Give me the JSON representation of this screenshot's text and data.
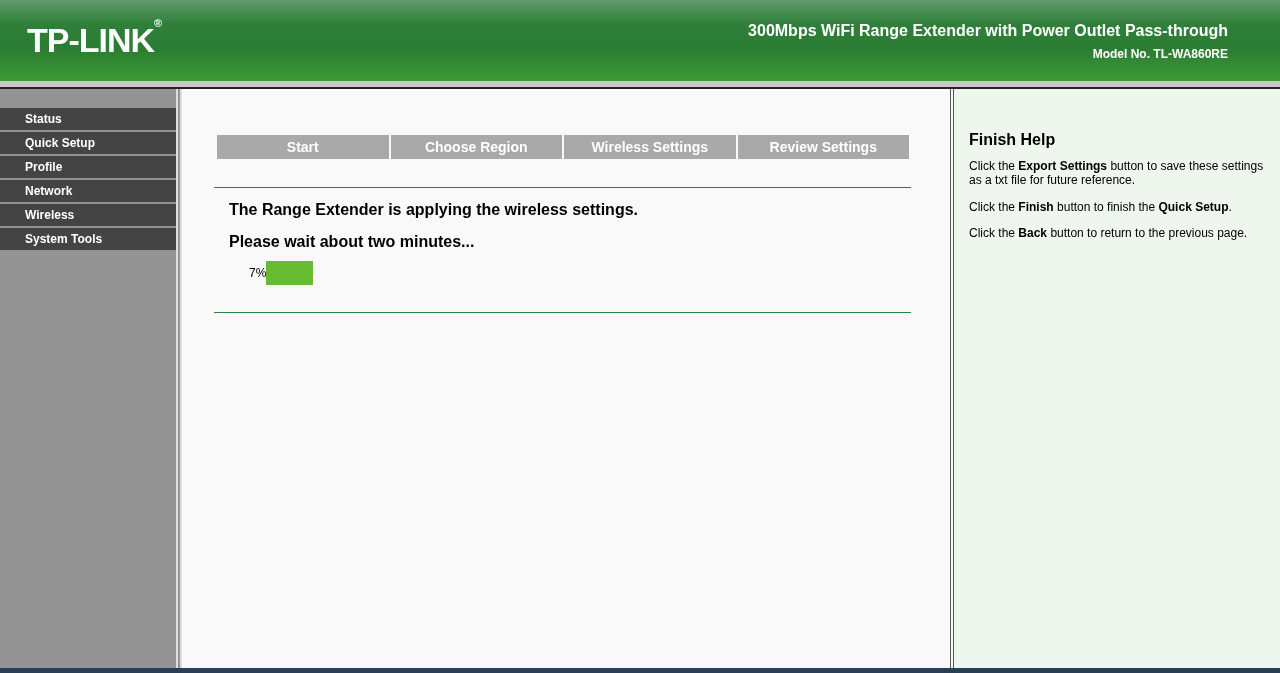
{
  "header": {
    "logo": "TP-LINK",
    "registered_mark": "®",
    "product_title": "300Mbps WiFi Range Extender with Power Outlet Pass-through",
    "model": "Model No. TL-WA860RE"
  },
  "sidebar": {
    "items": [
      {
        "label": "Status"
      },
      {
        "label": "Quick Setup"
      },
      {
        "label": "Profile"
      },
      {
        "label": "Network"
      },
      {
        "label": "Wireless"
      },
      {
        "label": "System Tools"
      }
    ]
  },
  "steps": [
    "Start",
    "Choose Region",
    "Wireless Settings",
    "Review Settings"
  ],
  "main": {
    "message": "The Range Extender is applying the wireless settings.",
    "wait": "Please wait about two minutes...",
    "progress": {
      "reading": "7%",
      "level": 0.07
    }
  },
  "help": {
    "title": "Finish Help",
    "paragraphs": [
      "Click the **Export Settings** button to save these settings as a txt file for future reference.",
      "Click the **Finish** button to finish the **Quick Setup**.",
      "Click the **Back** button to return to the previous page."
    ]
  }
}
